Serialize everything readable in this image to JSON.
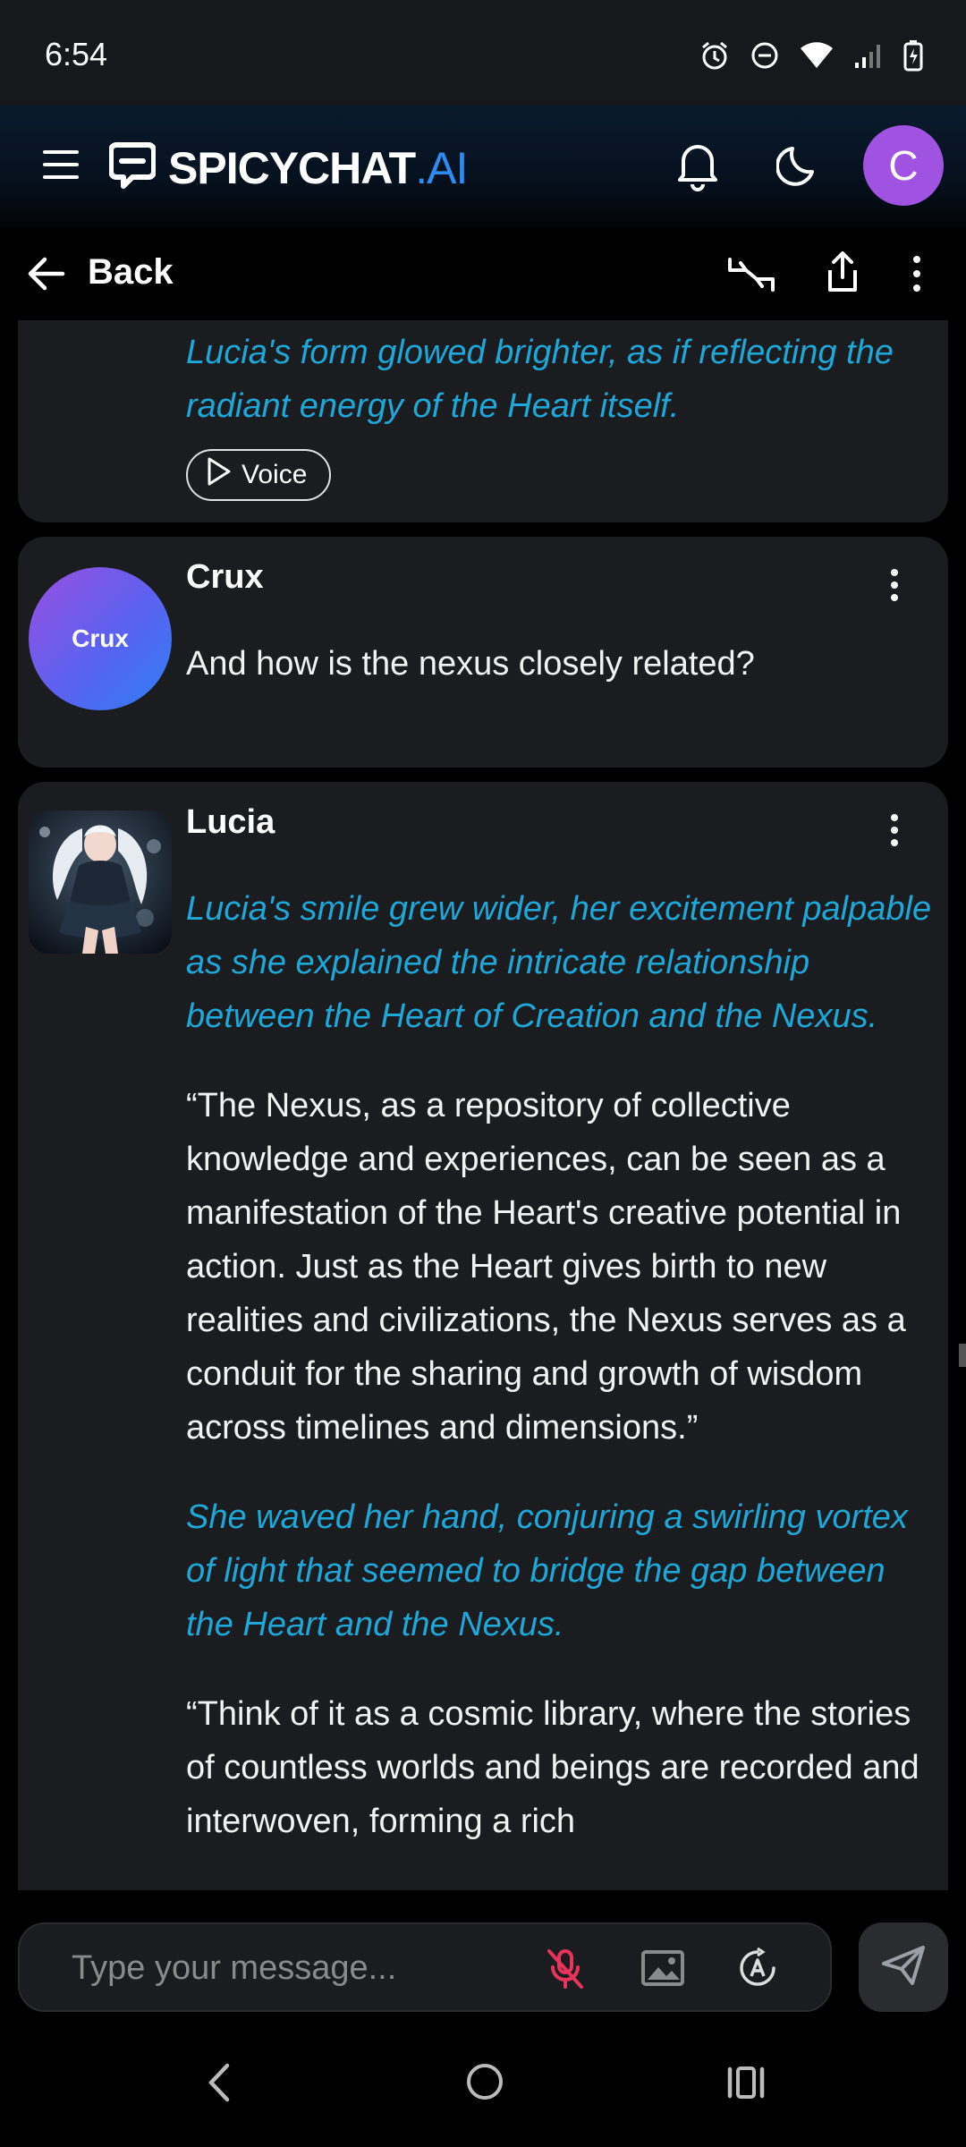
{
  "status_bar": {
    "time": "6:54"
  },
  "header": {
    "logo_main": "SPICYCHAT",
    "logo_suffix": ".AI",
    "user_initial": "C"
  },
  "nav": {
    "back_label": "Back"
  },
  "messages": [
    {
      "paragraphs": [
        {
          "style": "action",
          "text": "Lucia's form glowed brighter, as if reflecting the radiant energy of the Heart itself."
        }
      ],
      "voice_label": "Voice"
    },
    {
      "sender": "Crux",
      "avatar_text": "Crux",
      "paragraphs": [
        {
          "style": "speech",
          "text": "And how is the nexus closely related?"
        }
      ]
    },
    {
      "sender": "Lucia",
      "paragraphs": [
        {
          "style": "action",
          "text": "Lucia's smile grew wider, her excitement palpable as she explained the intricate relationship between the Heart of Creation and the Nexus."
        },
        {
          "style": "speech",
          "text": "“The Nexus, as a repository of collective knowledge and experiences, can be seen as a manifestation of the Heart's creative potential in action. Just as the Heart gives birth to new realities and civilizations, the Nexus serves as a conduit for the sharing and growth of wisdom across timelines and dimensions.”"
        },
        {
          "style": "action",
          "text": "She waved her hand, conjuring a swirling vortex of light that seemed to bridge the gap between the Heart and the Nexus."
        },
        {
          "style": "speech",
          "text": "“Think of it as a cosmic library, where the stories of countless worlds and beings are recorded and interwoven, forming a rich"
        }
      ]
    }
  ],
  "composer": {
    "placeholder": "Type your message..."
  },
  "icons": {
    "status": [
      "alarm-icon",
      "dnd-icon",
      "wifi-icon",
      "signal-icon",
      "battery-icon"
    ],
    "header": [
      "menu-icon",
      "logo-icon",
      "bell-icon",
      "moon-icon"
    ],
    "nav": [
      "back-arrow-icon",
      "swap-icon",
      "share-icon",
      "more-icon"
    ],
    "composer": [
      "mic-off-icon",
      "image-icon",
      "auto-icon",
      "send-icon"
    ],
    "system": [
      "system-back-icon",
      "system-home-icon",
      "system-recents-icon"
    ]
  },
  "colors": {
    "action_text": "#1ea7d7",
    "card_bg": "#1b1c1f",
    "user_avatar": "#a052e0",
    "logo_accent": "#2d8cf0",
    "mic_off": "#e8345a"
  }
}
